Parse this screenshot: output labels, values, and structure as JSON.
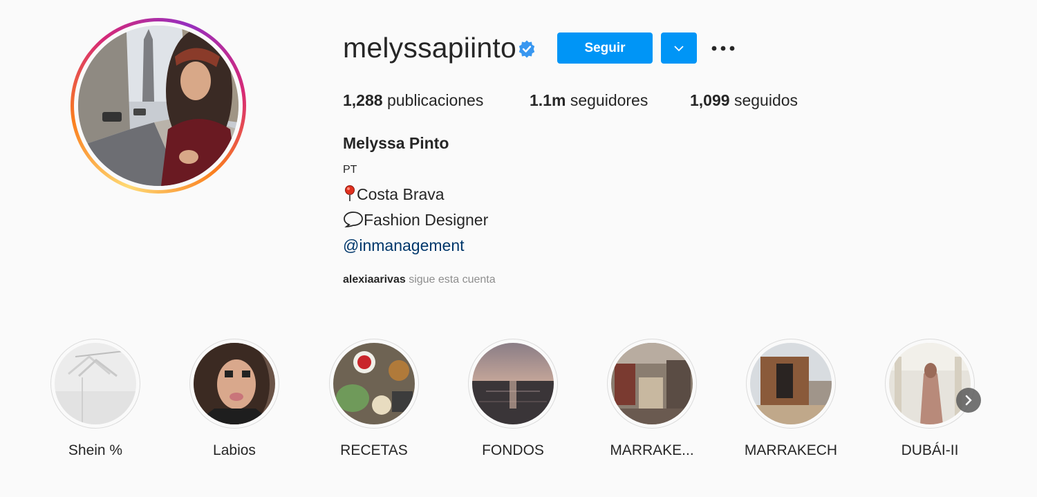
{
  "profile": {
    "username": "melyssapiinto",
    "verified": true,
    "follow_label": "Seguir",
    "accent": "#0095f6",
    "stats": {
      "posts_value": "1,288",
      "posts_label": "publicaciones",
      "followers_value": "1.1m",
      "followers_label": "seguidores",
      "following_value": "1,099",
      "following_label": "seguidos"
    },
    "full_name": "Melyssa Pinto",
    "bio": {
      "line1": "PT",
      "line2": "Costa Brava",
      "line3": "Fashion Designer",
      "link": "@inmanagement"
    },
    "followed_by": {
      "user": "alexiaarivas",
      "text": "sigue esta cuenta"
    }
  },
  "highlights": [
    {
      "label": "Shein %"
    },
    {
      "label": "Labios"
    },
    {
      "label": "RECETAS"
    },
    {
      "label": "FONDOS"
    },
    {
      "label": "MARRAKE..."
    },
    {
      "label": "MARRAKECH"
    },
    {
      "label": "DUBÁI-II"
    }
  ]
}
